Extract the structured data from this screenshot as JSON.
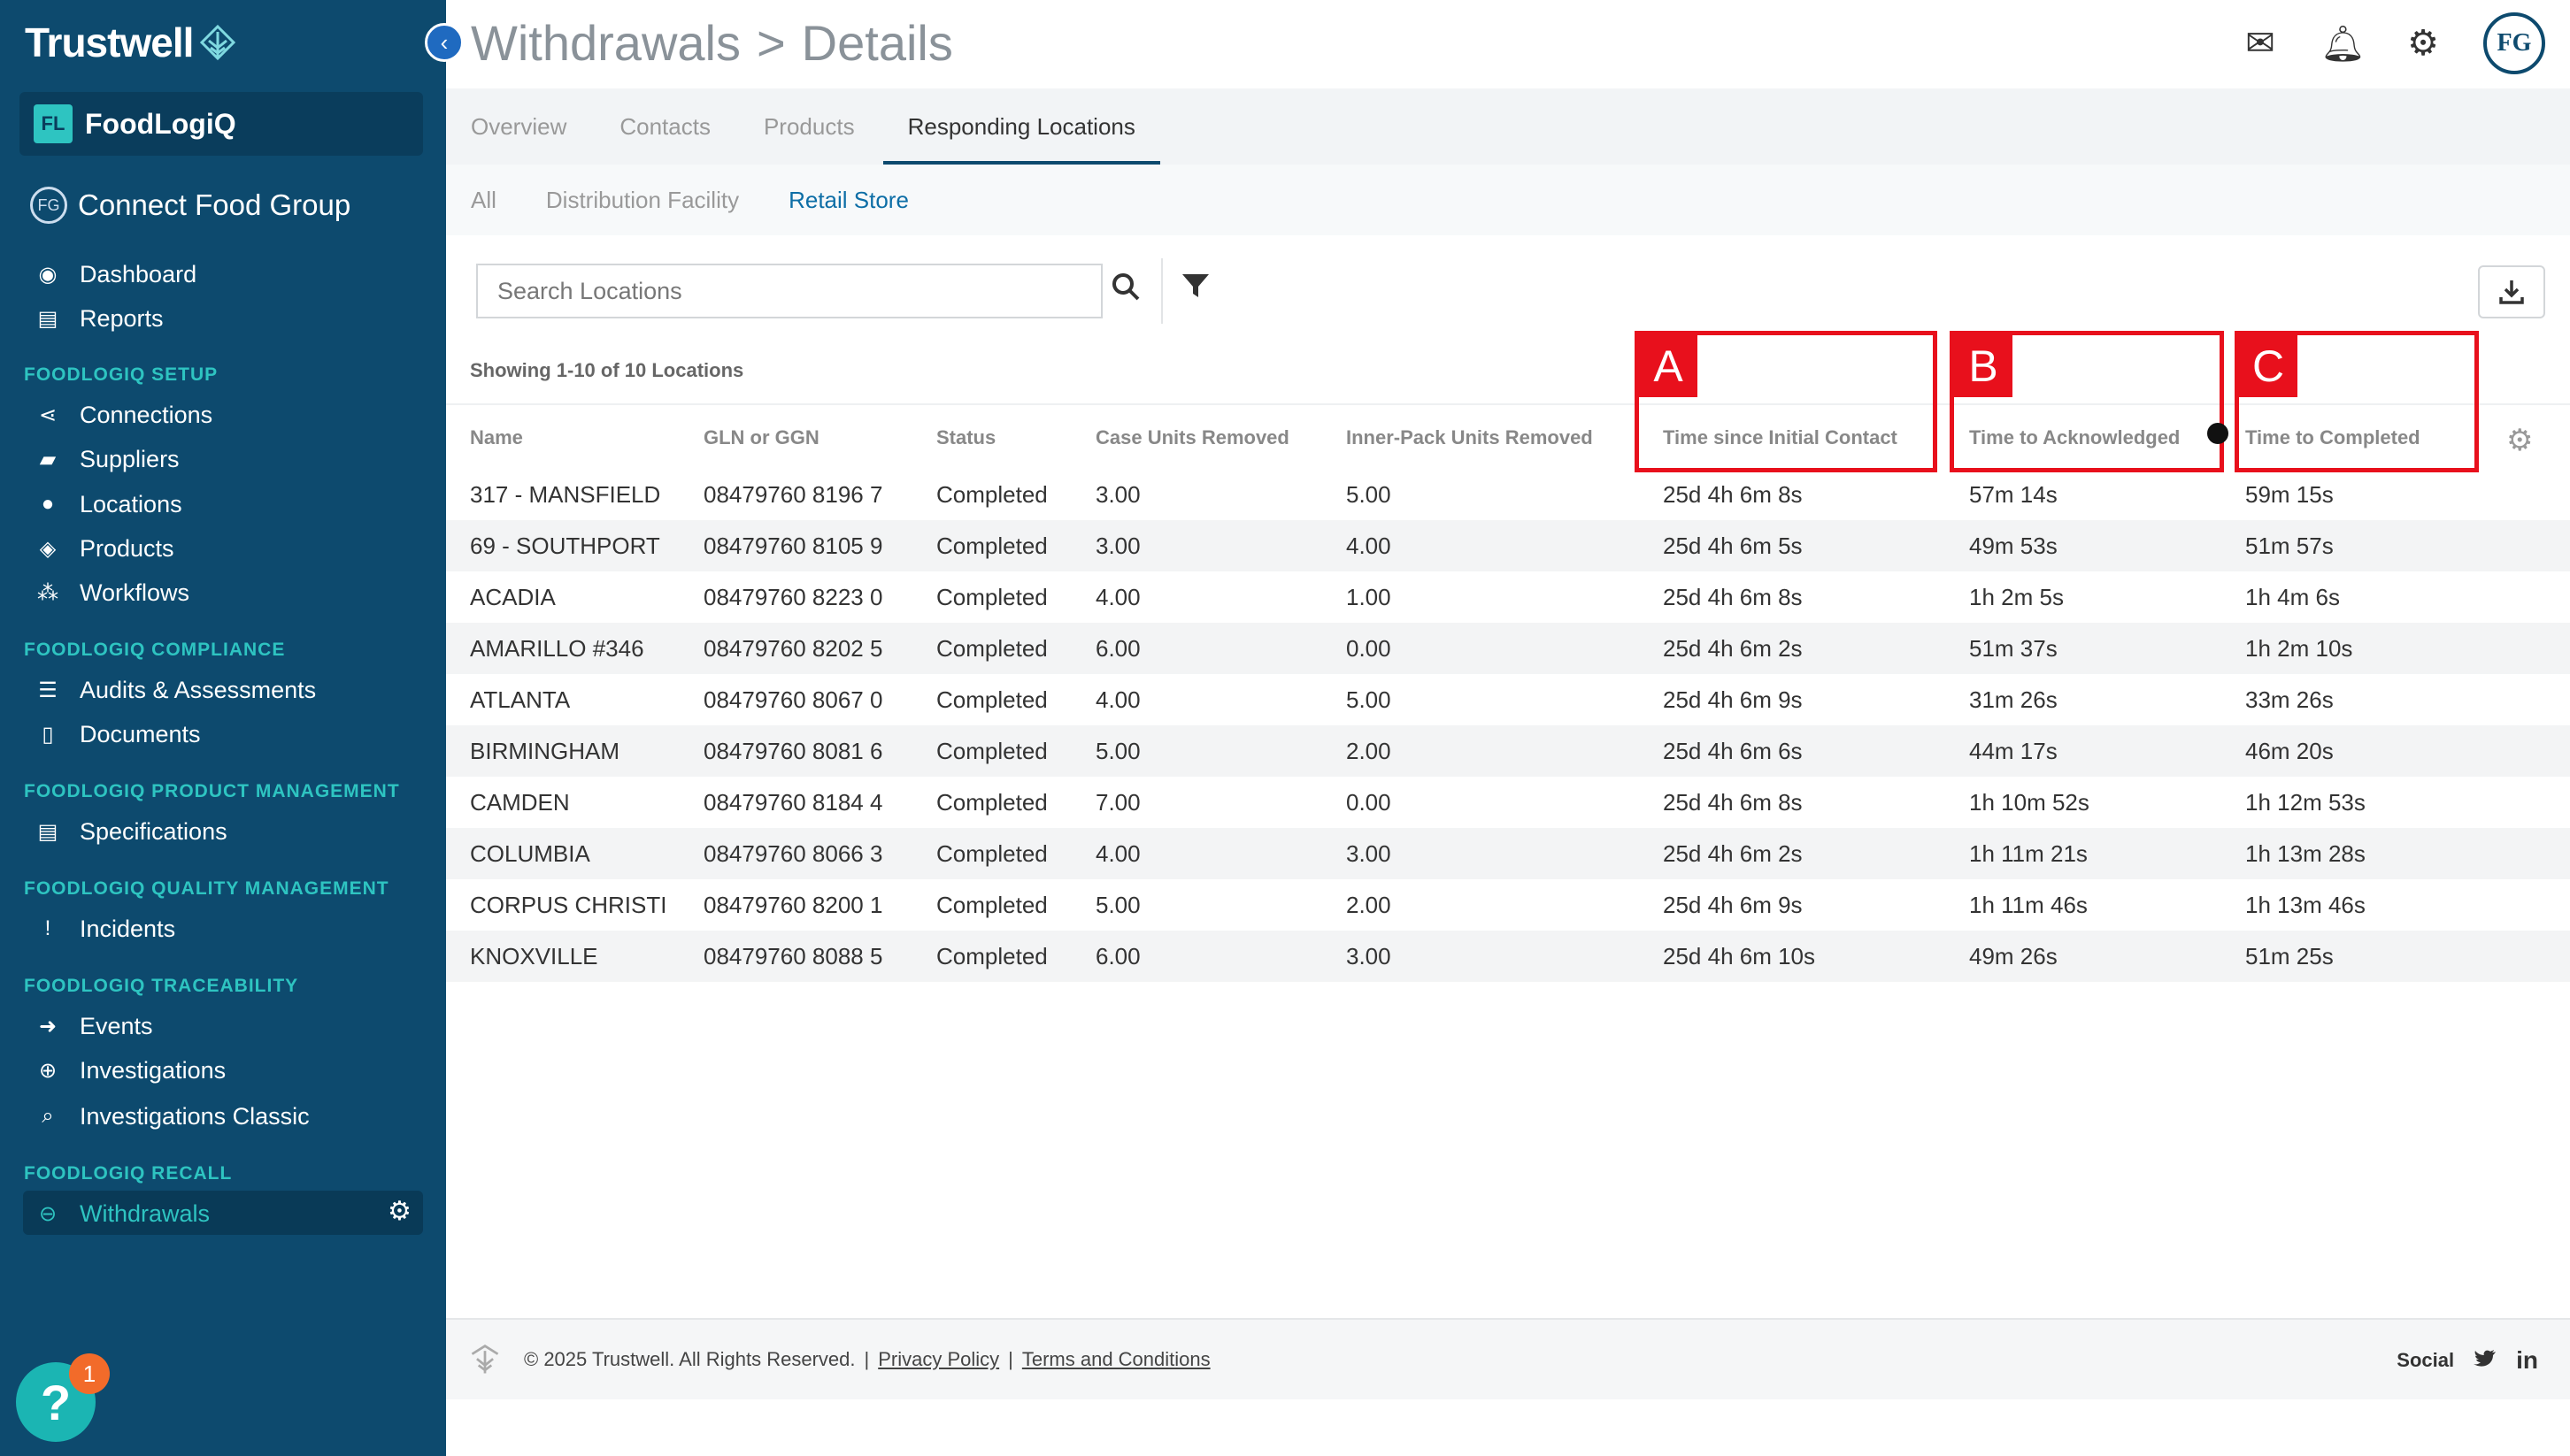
{
  "sidebar": {
    "brand": "Trustwell",
    "collapse_icon": "chevron-left-icon",
    "org_badge": "FL",
    "org_name": "FoodLogiQ",
    "group_badge": "FG",
    "group_name": "Connect Food Group",
    "items_top": [
      {
        "icon": "dashboard-icon",
        "label": "Dashboard"
      },
      {
        "icon": "reports-icon",
        "label": "Reports"
      }
    ],
    "sections": [
      {
        "title": "FOODLOGIQ SETUP",
        "items": [
          {
            "icon": "connections-icon",
            "label": "Connections"
          },
          {
            "icon": "truck-icon",
            "label": "Suppliers"
          },
          {
            "icon": "location-pin-icon",
            "label": "Locations"
          },
          {
            "icon": "box-icon",
            "label": "Products"
          },
          {
            "icon": "workflow-icon",
            "label": "Workflows"
          }
        ]
      },
      {
        "title": "FOODLOGIQ COMPLIANCE",
        "items": [
          {
            "icon": "list-icon",
            "label": "Audits & Assessments"
          },
          {
            "icon": "document-icon",
            "label": "Documents"
          }
        ]
      },
      {
        "title": "FOODLOGIQ PRODUCT MANAGEMENT",
        "items": [
          {
            "icon": "specification-icon",
            "label": "Specifications"
          }
        ]
      },
      {
        "title": "FOODLOGIQ QUALITY MANAGEMENT",
        "items": [
          {
            "icon": "exclamation-icon",
            "label": "Incidents"
          }
        ]
      },
      {
        "title": "FOODLOGIQ TRACEABILITY",
        "items": [
          {
            "icon": "sign-in-icon",
            "label": "Events"
          },
          {
            "icon": "crosshair-icon",
            "label": "Investigations"
          },
          {
            "icon": "search-icon",
            "label": "Investigations Classic"
          }
        ]
      },
      {
        "title": "FOODLOGIQ RECALL",
        "items": [
          {
            "icon": "minus-circle-icon",
            "label": "Withdrawals"
          }
        ]
      }
    ],
    "help_badge_count": "1"
  },
  "header": {
    "crumb_1": "Withdrawals",
    "separator": ">",
    "crumb_2": "Details",
    "avatar_initials": "FG"
  },
  "tabs": [
    "Overview",
    "Contacts",
    "Products",
    "Responding Locations"
  ],
  "active_tab": 3,
  "subtabs": [
    "All",
    "Distribution Facility",
    "Retail Store"
  ],
  "active_subtab": 2,
  "search": {
    "placeholder": "Search Locations"
  },
  "showing_text": "Showing 1-10 of 10 Locations",
  "table": {
    "columns": [
      "Name",
      "GLN or GGN",
      "Status",
      "Case Units Removed",
      "Inner-Pack Units Removed",
      "Time since Initial Contact",
      "Time to Acknowledged",
      "Time to Completed"
    ],
    "rows": [
      [
        "317 - MANSFIELD",
        "08479760 8196 7",
        "Completed",
        "3.00",
        "5.00",
        "25d 4h 6m 8s",
        "57m 14s",
        "59m 15s"
      ],
      [
        "69 - SOUTHPORT",
        "08479760 8105 9",
        "Completed",
        "3.00",
        "4.00",
        "25d 4h 6m 5s",
        "49m 53s",
        "51m 57s"
      ],
      [
        "ACADIA",
        "08479760 8223 0",
        "Completed",
        "4.00",
        "1.00",
        "25d 4h 6m 8s",
        "1h 2m 5s",
        "1h 4m 6s"
      ],
      [
        "AMARILLO #346",
        "08479760 8202 5",
        "Completed",
        "6.00",
        "0.00",
        "25d 4h 6m 2s",
        "51m 37s",
        "1h 2m 10s"
      ],
      [
        "ATLANTA",
        "08479760 8067 0",
        "Completed",
        "4.00",
        "5.00",
        "25d 4h 6m 9s",
        "31m 26s",
        "33m 26s"
      ],
      [
        "BIRMINGHAM",
        "08479760 8081 6",
        "Completed",
        "5.00",
        "2.00",
        "25d 4h 6m 6s",
        "44m 17s",
        "46m 20s"
      ],
      [
        "CAMDEN",
        "08479760 8184 4",
        "Completed",
        "7.00",
        "0.00",
        "25d 4h 6m 8s",
        "1h 10m 52s",
        "1h 12m 53s"
      ],
      [
        "COLUMBIA",
        "08479760 8066 3",
        "Completed",
        "4.00",
        "3.00",
        "25d 4h 6m 2s",
        "1h 11m 21s",
        "1h 13m 28s"
      ],
      [
        "CORPUS CHRISTI",
        "08479760 8200 1",
        "Completed",
        "5.00",
        "2.00",
        "25d 4h 6m 9s",
        "1h 11m 46s",
        "1h 13m 46s"
      ],
      [
        "KNOXVILLE",
        "08479760 8088 5",
        "Completed",
        "6.00",
        "3.00",
        "25d 4h 6m 10s",
        "49m 26s",
        "51m 25s"
      ]
    ]
  },
  "callouts": [
    "A",
    "B",
    "C"
  ],
  "footer": {
    "copyright": "© 2025 Trustwell. All Rights Reserved.",
    "sep": "|",
    "privacy": "Privacy Policy",
    "terms": "Terms and Conditions",
    "social_label": "Social"
  },
  "colors": {
    "sidebar": "#0d4a6e",
    "accent": "#2ec4c1",
    "callout": "#e8101c"
  }
}
